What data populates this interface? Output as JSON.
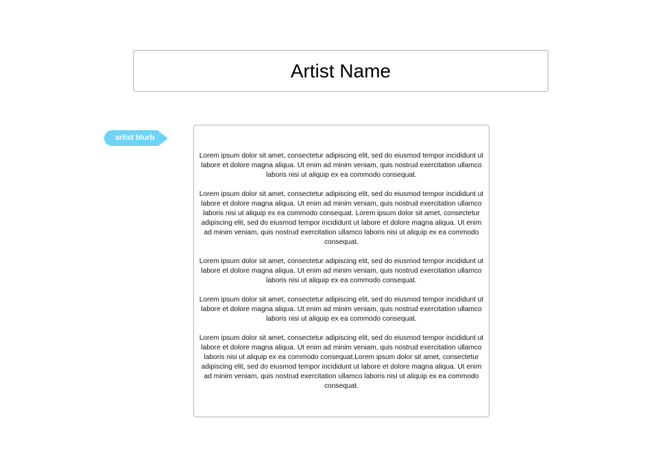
{
  "header": {
    "title": "Artist Name"
  },
  "annotation": {
    "label": "artist blurb",
    "color": "#6fd3f5"
  },
  "blurb": {
    "paragraphs": [
      "Lorem ipsum dolor sit amet, consectetur adipiscing elit, sed do eiusmod tempor incididunt ut labore et dolore magna aliqua. Ut enim ad minim veniam, quis nostrud exercitation ullamco laboris nisi ut aliquip ex ea commodo consequat.",
      "Lorem ipsum dolor sit amet, consectetur adipiscing elit, sed do eiusmod tempor incididunt ut labore et dolore magna aliqua. Ut enim ad minim veniam, quis nostrud exercitation ullamco laboris nisi ut aliquip ex ea commodo consequat. Lorem ipsum dolor sit amet, consectetur adipiscing elit, sed do eiusmod tempor incididunt ut labore et dolore magna aliqua. Ut enim ad minim veniam, quis nostrud exercitation ullamco laboris nisi ut aliquip ex ea commodo consequat.",
      "Lorem ipsum dolor sit amet, consectetur adipiscing elit, sed do eiusmod tempor incididunt ut labore et dolore magna aliqua. Ut enim ad minim veniam, quis nostrud exercitation ullamco laboris nisi ut aliquip ex ea commodo consequat.",
      "Lorem ipsum dolor sit amet, consectetur adipiscing elit, sed do eiusmod tempor incididunt ut labore et dolore magna aliqua. Ut enim ad minim veniam, quis nostrud exercitation ullamco laboris nisi ut aliquip ex ea commodo consequat.",
      "Lorem ipsum dolor sit amet, consectetur adipiscing elit, sed do eiusmod tempor incididunt ut labore et dolore magna aliqua. Ut enim ad minim veniam, quis nostrud exercitation ullamco laboris nisi ut aliquip ex ea commodo consequat.Lorem ipsum dolor sit amet, consectetur adipiscing elit, sed do eiusmod tempor incididunt ut labore et dolore magna aliqua. Ut enim ad minim veniam, quis nostrud exercitation ullamco laboris nisi ut aliquip ex ea commodo consequat."
    ]
  }
}
